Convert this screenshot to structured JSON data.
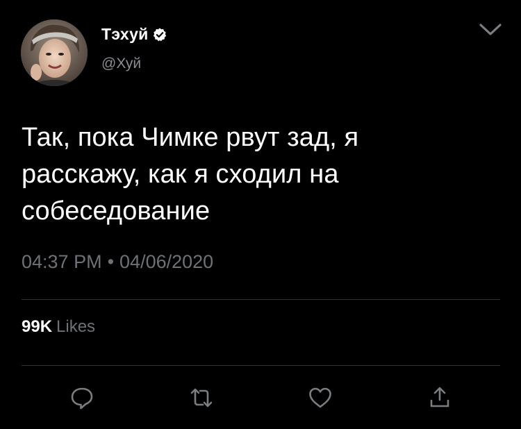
{
  "user": {
    "display_name": "Тэхуй",
    "handle": "@Хуй",
    "verified": true,
    "avatar_icon": "avatar-photo"
  },
  "tweet": {
    "text_lines": [
      "Так, пока Чимке рвут зад, я",
      "расскажу, как я сходил на",
      "собеседование"
    ],
    "time": "04:37 PM",
    "separator": "•",
    "date": "04/06/2020"
  },
  "stats": {
    "likes_count": "99K",
    "likes_label": "Likes"
  },
  "actions": [
    {
      "icon": "reply-icon"
    },
    {
      "icon": "retweet-icon"
    },
    {
      "icon": "like-icon"
    },
    {
      "icon": "share-icon"
    }
  ],
  "colors": {
    "background": "#000000",
    "text": "#ffffff",
    "secondary": "#6e7175",
    "divider": "#2f3336",
    "icon": "#7a7d81"
  }
}
